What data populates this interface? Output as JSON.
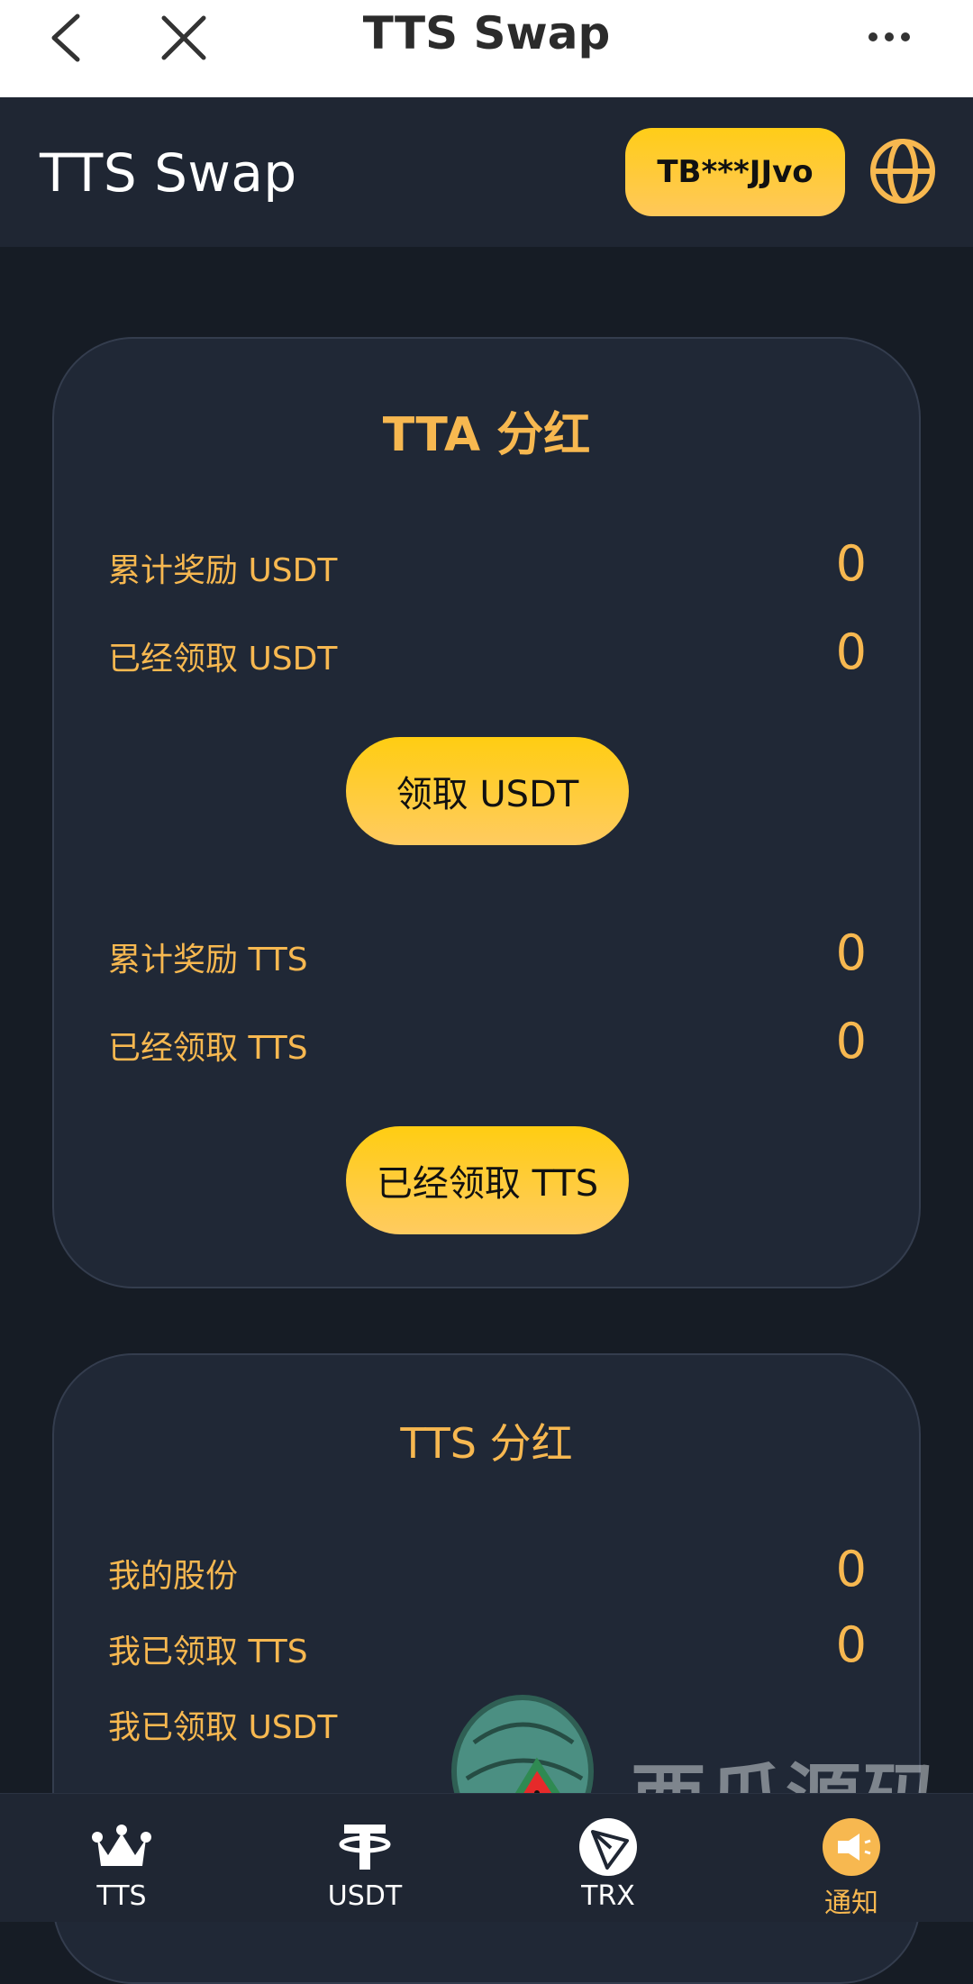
{
  "browser": {
    "title": "TTS Swap"
  },
  "header": {
    "app_title": "TTS Swap",
    "wallet_address": "TB***JJvo"
  },
  "tta_card": {
    "title": "TTA 分红",
    "rows_usdt": [
      {
        "label": "累计奖励 USDT",
        "value": "0"
      },
      {
        "label": "已经领取 USDT",
        "value": "0"
      }
    ],
    "claim_usdt_label": "领取 USDT",
    "rows_tts": [
      {
        "label": "累计奖励 TTS",
        "value": "0"
      },
      {
        "label": "已经领取 TTS",
        "value": "0"
      }
    ],
    "claim_tts_label": "已经领取 TTS"
  },
  "tts_card": {
    "title": "TTS 分红",
    "rows": [
      {
        "label": "我的股份",
        "value": "0"
      },
      {
        "label": "我已领取 TTS",
        "value": "0"
      },
      {
        "label": "我已领取 USDT",
        "value": ""
      }
    ]
  },
  "watermark": {
    "text": "西瓜源码"
  },
  "bottom_nav": {
    "items": [
      {
        "label": "TTS",
        "icon": "crown-icon"
      },
      {
        "label": "USDT",
        "icon": "tether-icon"
      },
      {
        "label": "TRX",
        "icon": "tron-icon"
      },
      {
        "label": "通知",
        "icon": "megaphone-icon"
      }
    ],
    "active_index": 3
  },
  "colors": {
    "accent": "#f7b850",
    "button": "#ffcd18",
    "background": "#161c25",
    "card": "#202836"
  }
}
